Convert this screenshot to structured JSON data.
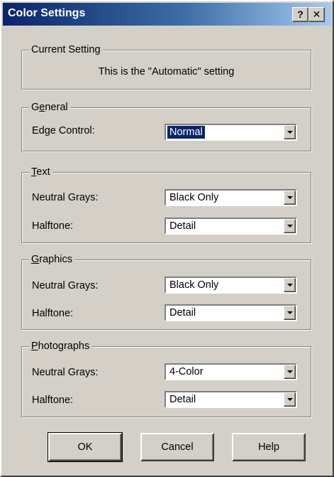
{
  "window": {
    "title": "Color Settings",
    "help_glyph": "?",
    "close_glyph": "✕"
  },
  "current_setting": {
    "legend": "Current Setting",
    "text": "This is the \"Automatic\" setting"
  },
  "general": {
    "legend_first": "G",
    "legend_mnemonic": "e",
    "legend_rest": "neral",
    "edge_control_label": "Edge Control:",
    "edge_control_value": "Normal"
  },
  "text_group": {
    "legend_mnemonic": "T",
    "legend_rest": "ext",
    "neutral_grays_label": "Neutral Grays:",
    "neutral_grays_value": "Black Only",
    "halftone_label": "Halftone:",
    "halftone_value": "Detail"
  },
  "graphics_group": {
    "legend_mnemonic": "G",
    "legend_rest": "raphics",
    "neutral_grays_label": "Neutral Grays:",
    "neutral_grays_value": "Black Only",
    "halftone_label": "Halftone:",
    "halftone_value": "Detail"
  },
  "photographs_group": {
    "legend_mnemonic": "P",
    "legend_rest": "hotographs",
    "neutral_grays_label": "Neutral Grays:",
    "neutral_grays_value": "4-Color",
    "halftone_label": "Halftone:",
    "halftone_value": "Detail"
  },
  "buttons": {
    "ok": "OK",
    "cancel": "Cancel",
    "help": "Help"
  },
  "icons": [
    "help-icon",
    "close-icon",
    "chevron-down-icon"
  ]
}
